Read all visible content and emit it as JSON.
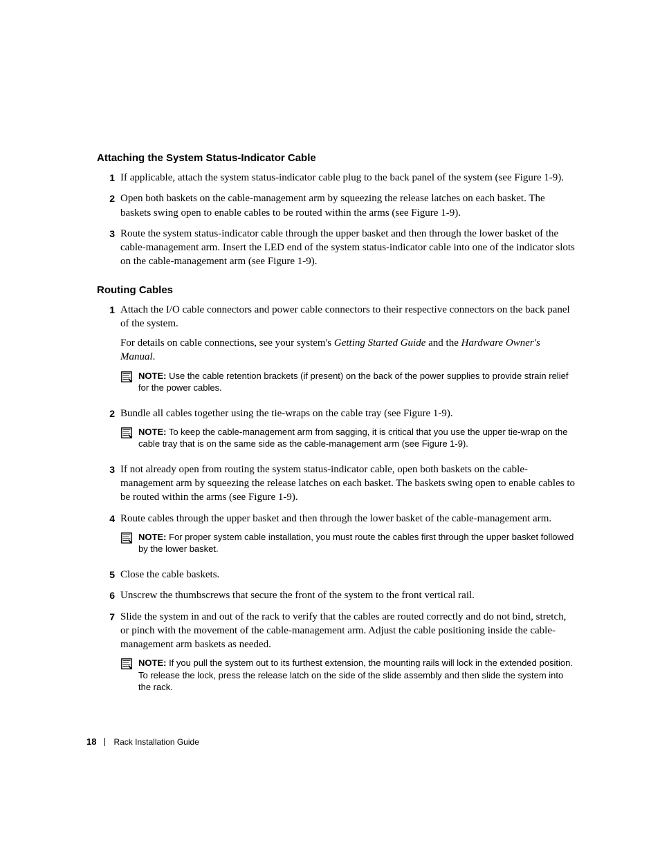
{
  "section1": {
    "heading": "Attaching the System Status-Indicator Cable",
    "steps": [
      {
        "num": "1",
        "text": "If applicable, attach the system status-indicator cable plug to the back panel of the system (see Figure 1-9)."
      },
      {
        "num": "2",
        "text": "Open both baskets on the cable-management arm by squeezing the release latches on each basket. The baskets swing open to enable cables to be routed within the arms (see Figure 1-9)."
      },
      {
        "num": "3",
        "text": "Route the system status-indicator cable through the upper basket and then through the lower basket of the cable-management arm. Insert the LED end of the system status-indicator cable into one of the indicator slots on the cable-management arm (see Figure 1-9)."
      }
    ]
  },
  "section2": {
    "heading": "Routing Cables",
    "steps": [
      {
        "num": "1",
        "paragraphs": [
          {
            "plain": "Attach the I/O cable connectors and power cable connectors to their respective connectors on the back panel of the system."
          },
          {
            "prefix": "For details on cable connections, see your system's ",
            "italic1": "Getting Started Guide",
            "mid": " and the ",
            "italic2": "Hardware Owner's Manual",
            "suffix": "."
          }
        ],
        "note": {
          "label": "NOTE:",
          "text": " Use the cable retention brackets (if present) on the back of the power supplies to provide strain relief for the power cables."
        }
      },
      {
        "num": "2",
        "paragraphs": [
          {
            "plain": "Bundle all cables together using the tie-wraps on the cable tray (see Figure 1-9)."
          }
        ],
        "note": {
          "label": "NOTE:",
          "text": " To keep the cable-management arm from sagging, it is critical that you use the upper tie-wrap on the cable tray that is on the same side as the cable-management arm (see Figure 1-9)."
        }
      },
      {
        "num": "3",
        "paragraphs": [
          {
            "plain": "If not already open from routing the system status-indicator cable, open both baskets on the cable-management arm by squeezing the release latches on each basket. The baskets swing open to enable cables to be routed within the arms (see Figure 1-9)."
          }
        ]
      },
      {
        "num": "4",
        "paragraphs": [
          {
            "plain": "Route cables through the upper basket and then through the lower basket of the cable-management arm."
          }
        ],
        "note": {
          "label": "NOTE:",
          "text": " For proper system cable installation, you must route the cables first through the upper basket followed by the lower basket."
        }
      },
      {
        "num": "5",
        "paragraphs": [
          {
            "plain": "Close the cable baskets."
          }
        ]
      },
      {
        "num": "6",
        "paragraphs": [
          {
            "plain": "Unscrew the thumbscrews that secure the front of the system to the front vertical rail."
          }
        ]
      },
      {
        "num": "7",
        "paragraphs": [
          {
            "plain": "Slide the system in and out of the rack to verify that the cables are routed correctly and do not bind, stretch, or pinch with the movement of the cable-management arm. Adjust the cable positioning inside the cable-management arm baskets as needed."
          }
        ],
        "note": {
          "label": "NOTE:",
          "text": " If you pull the system out to its furthest extension, the mounting rails will lock in the extended position. To release the lock, press the release latch on the side of the slide assembly and then slide the system into the rack."
        }
      }
    ]
  },
  "footer": {
    "page": "18",
    "title": "Rack Installation Guide"
  }
}
